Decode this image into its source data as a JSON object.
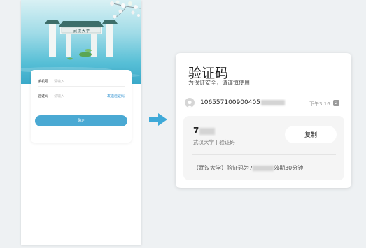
{
  "login": {
    "phone_label": "手机号",
    "phone_placeholder": "请输入",
    "code_label": "验证码",
    "code_placeholder": "请输入",
    "send_code": "发送验证码",
    "submit_label": "确定",
    "gate_text": "武汉大学"
  },
  "sms": {
    "title": "验证码",
    "subtitle": "为保证安全，请谨慎使用",
    "sender_visible": "106557100900405",
    "time": "下午3:16",
    "sim_badge": "2",
    "code_visible": "7",
    "source": "武汉大学 | 验证码",
    "copy_label": "复制",
    "message_prefix": "【武汉大学】验证码为7",
    "message_suffix": "效期30分钟"
  },
  "colors": {
    "accent": "#4aa9d3",
    "arrow": "#3ea9d8",
    "link": "#2b8fd0"
  }
}
